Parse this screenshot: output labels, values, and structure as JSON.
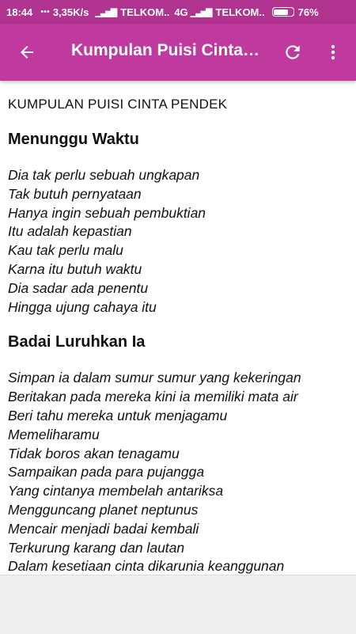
{
  "status_bar": {
    "time": "18:44",
    "speed": "3,35K/s",
    "sim1_carrier": "TELKOM..",
    "network_type": "4G",
    "sim2_carrier": "TELKOM..",
    "battery_percent": "76%",
    "battery_level": 0.76
  },
  "app_bar": {
    "title": "Kumpulan Puisi Cinta Pendek",
    "back_icon": "arrow-back-icon",
    "refresh_icon": "refresh-icon",
    "more_icon": "more-vert-icon"
  },
  "article": {
    "heading": "KUMPULAN PUISI CINTA PENDEK",
    "poems": [
      {
        "title": "Menunggu Waktu",
        "lines": [
          "Dia tak perlu sebuah ungkapan",
          "Tak butuh pernyataan",
          "Hanya ingin sebuah pembuktian",
          "Itu adalah kepastian",
          "Kau tak perlu malu",
          "Karna itu butuh waktu",
          "Dia sadar ada penentu",
          "Hingga ujung cahaya itu"
        ]
      },
      {
        "title": "Badai Luruhkan Ia",
        "lines": [
          "Simpan ia dalam sumur sumur yang kekeringan",
          "Beritakan pada mereka kini ia memiliki mata air",
          "Beri tahu mereka untuk menjagamu",
          "Memeliharamu",
          "Tidak boros akan tenagamu",
          "Sampaikan pada para pujangga",
          "Yang cintanya membelah antariksa",
          "Mengguncang planet neptunus",
          "Mencair menjadi badai kembali",
          "Terkurung karang dan lautan",
          "Dalam kesetiaan cinta dikarunia keanggunan"
        ]
      }
    ]
  },
  "colors": {
    "status_bar": "#b0338f",
    "app_bar": "#c0399f",
    "text": "#111111",
    "bottom_panel": "#efefef"
  }
}
